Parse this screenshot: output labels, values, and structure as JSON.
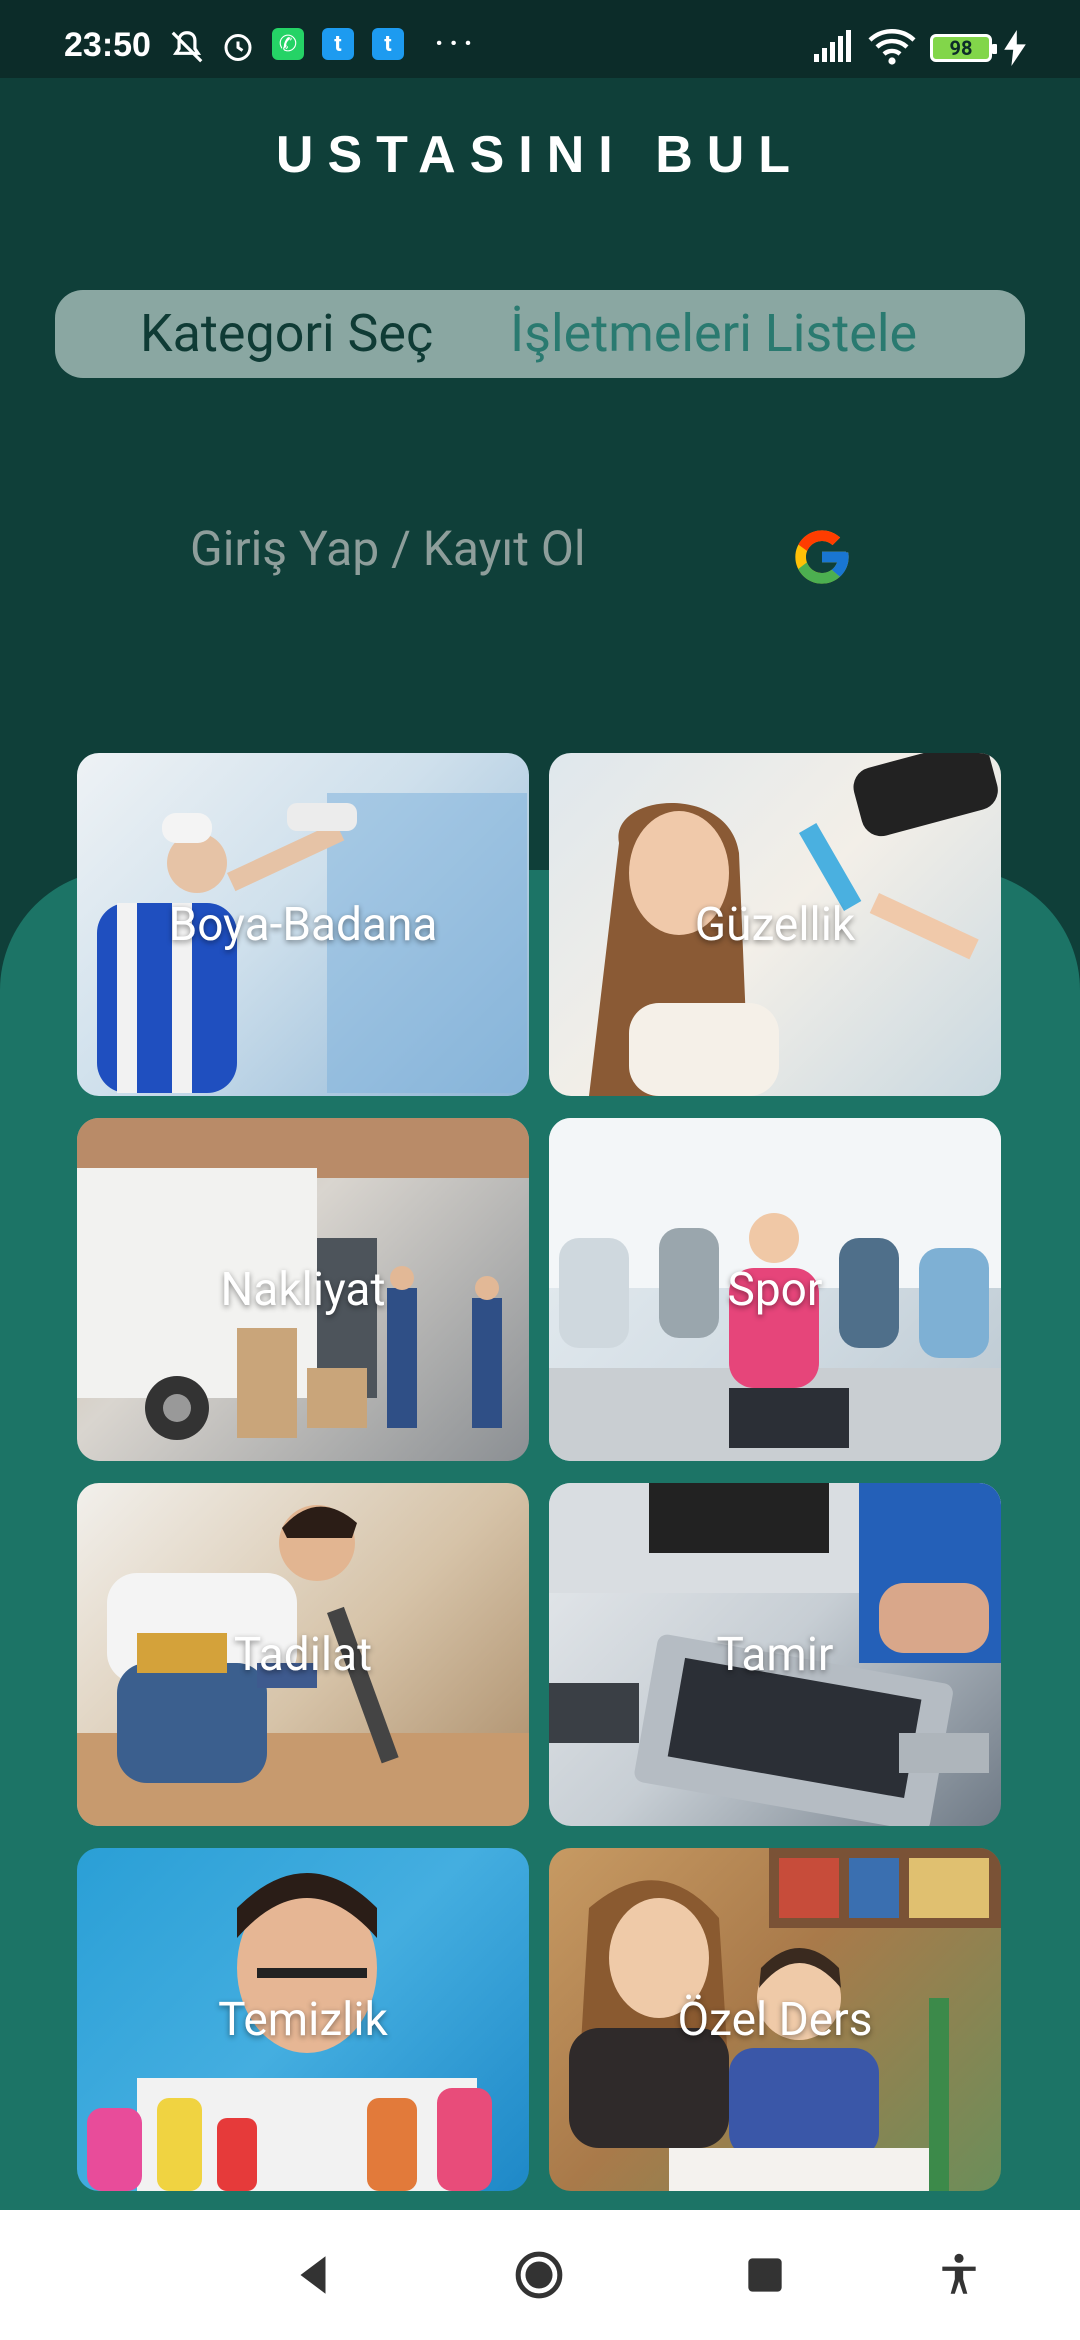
{
  "status": {
    "time": "23:50",
    "battery": "98"
  },
  "app": {
    "title": "USTASINI BUL"
  },
  "tabs": {
    "category": "Kategori Seç",
    "businesses": "İşletmeleri Listele"
  },
  "login": {
    "label": "Giriş Yap / Kayıt Ol"
  },
  "categories": [
    {
      "label": "Boya-Badana"
    },
    {
      "label": "Güzellik"
    },
    {
      "label": "Nakliyat"
    },
    {
      "label": "Spor"
    },
    {
      "label": "Tadilat"
    },
    {
      "label": "Tamir"
    },
    {
      "label": "Temizlik"
    },
    {
      "label": "Özel Ders"
    }
  ],
  "colors": {
    "background": "#0f3f39",
    "panel": "#1c7466",
    "segment": "#8aa7a2",
    "active_tab_text": "#0f3b35",
    "inactive_tab_text": "#2a7a70"
  }
}
